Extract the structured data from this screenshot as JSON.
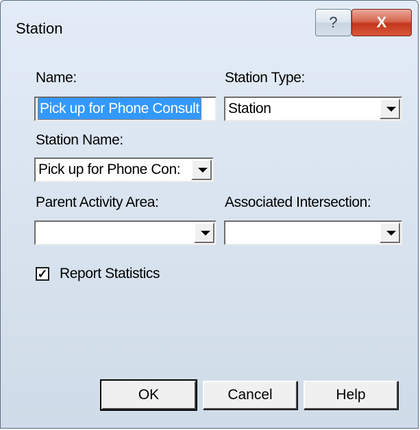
{
  "window": {
    "title": "Station",
    "help_label": "?",
    "close_label": "X"
  },
  "form": {
    "name_label": "Name:",
    "name_value": "Pick up for Phone Consult",
    "station_type_label": "Station Type:",
    "station_type_value": "Station",
    "station_name_label": "Station Name:",
    "station_name_value": "Pick up for Phone Con:",
    "parent_area_label": "Parent Activity Area:",
    "parent_area_value": "",
    "assoc_intersection_label": "Associated Intersection:",
    "assoc_intersection_value": "",
    "report_statistics_label": "Report Statistics",
    "report_statistics_checked": true
  },
  "buttons": {
    "ok": "OK",
    "cancel": "Cancel",
    "help": "Help"
  }
}
